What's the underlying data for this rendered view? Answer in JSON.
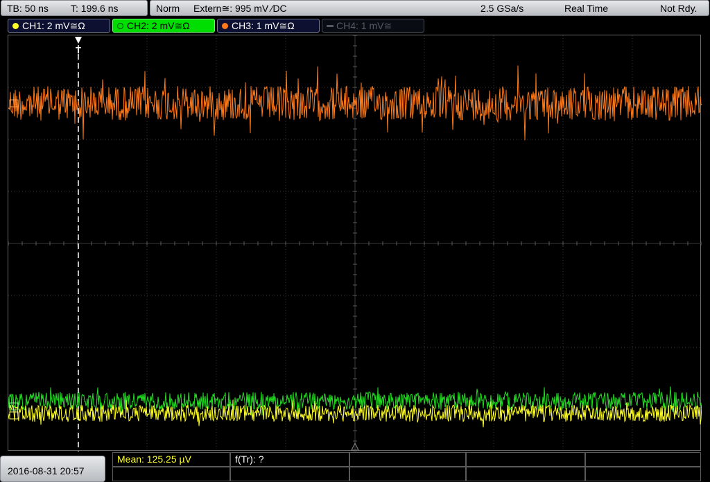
{
  "statusbar": {
    "timebase": "TB: 50 ns",
    "trigger_time": "T: 199.6 ns",
    "trigger_mode": "Norm",
    "trigger_source": "Extern≅: 995 mV ⁄DC",
    "sample_rate": "2.5 GSa/s",
    "acq_mode": "Real Time",
    "status": "Not Rdy."
  },
  "channels": [
    {
      "label": "CH1: 2 mV≅Ω",
      "color": "#ffff2a",
      "active": true
    },
    {
      "label": "CH2: 2 mV≅Ω",
      "color": "#00dd00",
      "active": true,
      "selected": true
    },
    {
      "label": "CH3: 1 mV≅Ω",
      "color": "#ff7a1a",
      "active": true
    },
    {
      "label": "CH4: 1 mV≅",
      "color": "#555a62",
      "active": false
    }
  ],
  "trigger_marker": "T",
  "footer": {
    "datetime": "2016-08-31 20:57",
    "measurement_mean": "Mean: 125.25 µV",
    "measurement_ftr": "f(Tr): ?"
  },
  "colors": {
    "ch1": "#ffff2a",
    "ch2": "#22dd22",
    "ch3": "#ff7a1a",
    "grid": "#3a3a3a",
    "frame": "#6a6a6a"
  }
}
